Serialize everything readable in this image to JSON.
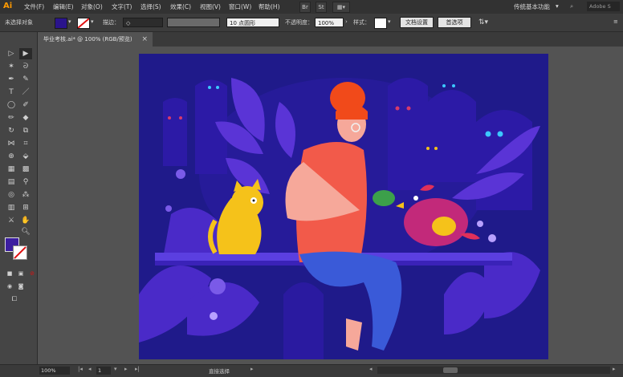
{
  "menubar": {
    "logo": "Ai",
    "items": [
      "文件(F)",
      "编辑(E)",
      "对象(O)",
      "文字(T)",
      "选择(S)",
      "效果(C)",
      "视图(V)",
      "窗口(W)",
      "帮助(H)"
    ],
    "br_label": "Br",
    "st_label": "St",
    "workspace": "传统基本功能",
    "search_placeholder": "Adobe S"
  },
  "controlbar": {
    "selection_status": "未选择对象",
    "stroke_label": "描边：",
    "brush_size": "10 点圆形",
    "opacity_label": "不透明度：",
    "opacity_value": "100%",
    "style_label": "样式：",
    "doc_setup_button": "文档设置",
    "preferences_button": "首选项",
    "colors": {
      "fill": "#2a148c",
      "stroke": "#ffffff",
      "stroke_slash": "#e01010"
    }
  },
  "document": {
    "tab_title": "毕业考核.ai* @ 100% (RGB/预览)",
    "close_icon": "×"
  },
  "statusbar": {
    "zoom": "100%",
    "page": "1",
    "current_tool": "直接选择"
  },
  "colors": {
    "artboard_bg": "#1f1a8a",
    "accent": "#ff9a00"
  }
}
